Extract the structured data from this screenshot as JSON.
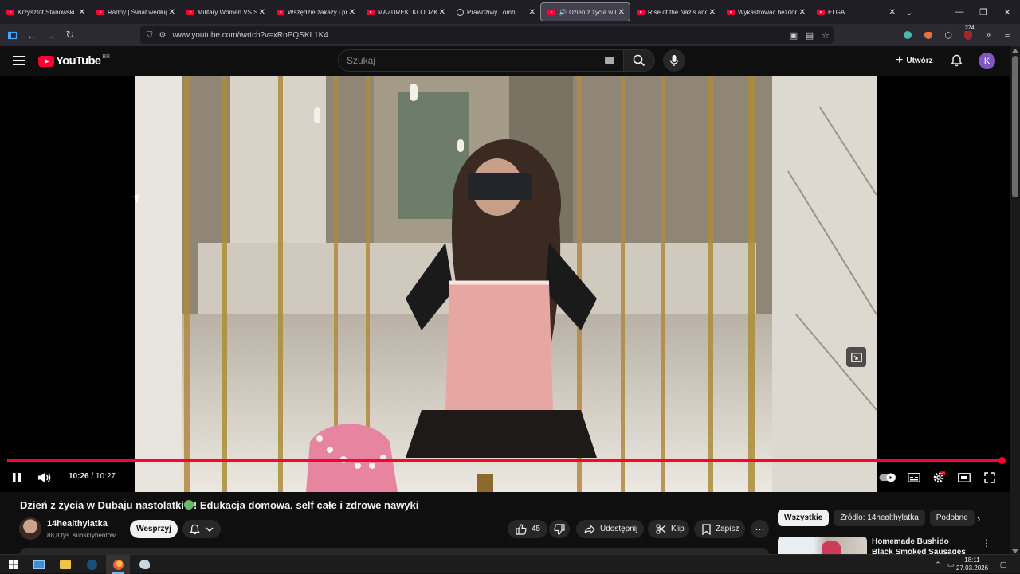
{
  "browser": {
    "tabs": [
      {
        "label": "Krzysztof Stanowski.",
        "icon": "youtube-icon",
        "active": false
      },
      {
        "label": "Radny | Świat według",
        "icon": "youtube-icon",
        "active": false
      },
      {
        "label": "Military Women VS S",
        "icon": "youtube-icon",
        "active": false
      },
      {
        "label": "Wszędzie zakazy i pr",
        "icon": "youtube-icon",
        "active": false
      },
      {
        "label": "MAZUREK: KŁODZKO",
        "icon": "youtube-icon",
        "active": false
      },
      {
        "label": "Prawdziwy Lomb",
        "icon": "record-icon",
        "active": false
      },
      {
        "label": "Dzień z życia w D",
        "icon": "youtube-icon",
        "active": true
      },
      {
        "label": "Rise of the Nazis and",
        "icon": "youtube-icon",
        "active": false
      },
      {
        "label": "Wykastrować bezdom",
        "icon": "youtube-icon",
        "active": false
      },
      {
        "label": "ELGA",
        "icon": "youtube-icon",
        "active": false
      }
    ],
    "url": "www.youtube.com/watch?v=xRoPQSKL1K4",
    "extension_badge": "274"
  },
  "youtube": {
    "logo_text": "YouTube",
    "country_code": "BR",
    "search_placeholder": "Szukaj",
    "create_label": "Utwórz",
    "avatar_letter": "K"
  },
  "player": {
    "current_time": "10:26",
    "duration": "10:27",
    "time_separator": " / ",
    "progress_fraction": 0.998,
    "accent_color": "#ff0033",
    "settings_badge": "HD"
  },
  "video": {
    "title_part1": "Dzień z życia w Dubaju nastolatki",
    "title_part2": "! Edukacja domowa, self całe i zdrowe nawyki",
    "channel_name": "14healthylatka",
    "subscribers": "88,8 tys. subskrybentów",
    "support_label": "Wesprzyj",
    "like_count": "45",
    "share_label": "Udostępnij",
    "clip_label": "Klip",
    "save_label": "Zapisz"
  },
  "sidebar": {
    "chips": [
      "Wszystkie",
      "Źródło: 14healthylatka",
      "Podobne"
    ],
    "recommended": [
      {
        "title": "Homemade Bushido Black Smoked Sausages in the"
      }
    ]
  },
  "taskbar": {
    "time": "18:11",
    "date": "27.03.2026"
  }
}
